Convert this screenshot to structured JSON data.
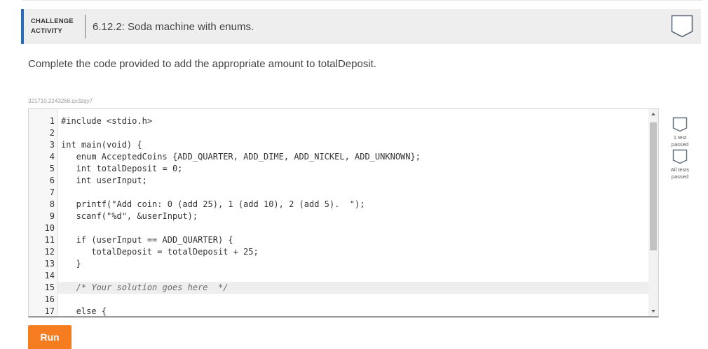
{
  "activity": {
    "type_line1": "CHALLENGE",
    "type_line2": "ACTIVITY",
    "title": "6.12.2: Soda machine with enums.",
    "completion_icon": "badge-outline-icon"
  },
  "instructions": "Complete the code provided to add the appropriate amount to totalDeposit.",
  "activity_id": "321710.2243268.qx3zqy7",
  "editor": {
    "active_line": 15,
    "lines": [
      {
        "n": "1",
        "code": "#include <stdio.h>"
      },
      {
        "n": "2",
        "code": ""
      },
      {
        "n": "3",
        "code": "int main(void) {"
      },
      {
        "n": "4",
        "code": "   enum AcceptedCoins {ADD_QUARTER, ADD_DIME, ADD_NICKEL, ADD_UNKNOWN};"
      },
      {
        "n": "5",
        "code": "   int totalDeposit = 0;"
      },
      {
        "n": "6",
        "code": "   int userInput;"
      },
      {
        "n": "7",
        "code": ""
      },
      {
        "n": "8",
        "code": "   printf(\"Add coin: 0 (add 25), 1 (add 10), 2 (add 5).  \");"
      },
      {
        "n": "9",
        "code": "   scanf(\"%d\", &userInput);"
      },
      {
        "n": "10",
        "code": ""
      },
      {
        "n": "11",
        "code": "   if (userInput == ADD_QUARTER) {"
      },
      {
        "n": "12",
        "code": "      totalDeposit = totalDeposit + 25;"
      },
      {
        "n": "13",
        "code": "   }"
      },
      {
        "n": "14",
        "code": ""
      },
      {
        "n": "15",
        "code": "   /* Your solution goes here  */"
      },
      {
        "n": "16",
        "code": ""
      },
      {
        "n": "17",
        "code": "   else {"
      }
    ]
  },
  "tests": [
    {
      "line1": "1 test",
      "line2": "passed",
      "icon": "test-status-icon"
    },
    {
      "line1": "All tests",
      "line2": "passed",
      "icon": "test-status-icon"
    }
  ],
  "run_label": "Run"
}
